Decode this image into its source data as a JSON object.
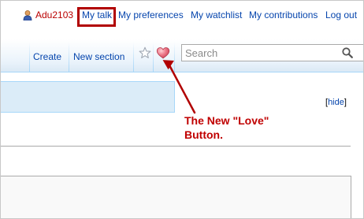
{
  "personal_tools": {
    "username": "Adu2103",
    "items": [
      "My talk",
      "My preferences",
      "My watchlist",
      "My contributions",
      "Log out"
    ]
  },
  "tabs": {
    "create": "Create",
    "new_section": "New section"
  },
  "icons": {
    "user": "user-icon",
    "watch": "star-icon",
    "love": "heart-icon",
    "search": "magnifier-icon"
  },
  "search": {
    "placeholder": "Search",
    "value": ""
  },
  "notice": {
    "hide_open": "[",
    "hide_label": "hide",
    "hide_close": "]"
  },
  "annotation": {
    "line1": "The New \"Love\"",
    "line2": "Button."
  },
  "colors": {
    "link": "#0645ad",
    "user_link": "#ba0000",
    "highlight": "#b10000",
    "annotation": "#c00000",
    "heart": "#e06074"
  }
}
